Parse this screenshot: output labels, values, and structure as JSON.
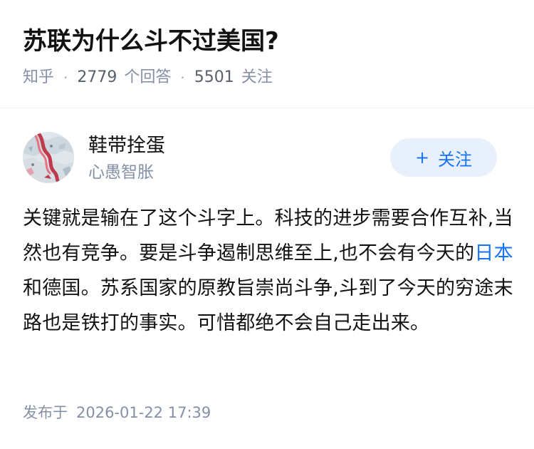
{
  "question": {
    "title": "苏联为什么斗不过美国?",
    "meta": {
      "source": "知乎",
      "separator": "·",
      "answer_count": "2779",
      "answer_label": "个回答",
      "follower_count": "5501",
      "follower_label": "关注"
    }
  },
  "answer": {
    "author": {
      "name": "鞋带拴蛋",
      "bio": "心愚智胀",
      "avatar_icon": "map-avatar-icon"
    },
    "follow_button": {
      "icon": "+",
      "label": "关注"
    },
    "content": {
      "part1": "关键就是输在了这个斗字上。科技的进步需要合作互补,当然也有竞争。要是斗争遏制思维至上,也不会有今天的",
      "link_text": "日本",
      "part2": "和德国。苏系国家的原教旨崇尚斗争,斗到了今天的穷途末路也是铁打的事实。可惜都绝不会自己走出来。"
    },
    "publish": {
      "label": "发布于",
      "time": "2026-01-22 17:39"
    }
  },
  "colors": {
    "title": "#121212",
    "meta_gray": "#8590a6",
    "link_blue": "#1772f6",
    "follow_bg": "#e8f1fb",
    "divider": "#f0f1f3"
  }
}
